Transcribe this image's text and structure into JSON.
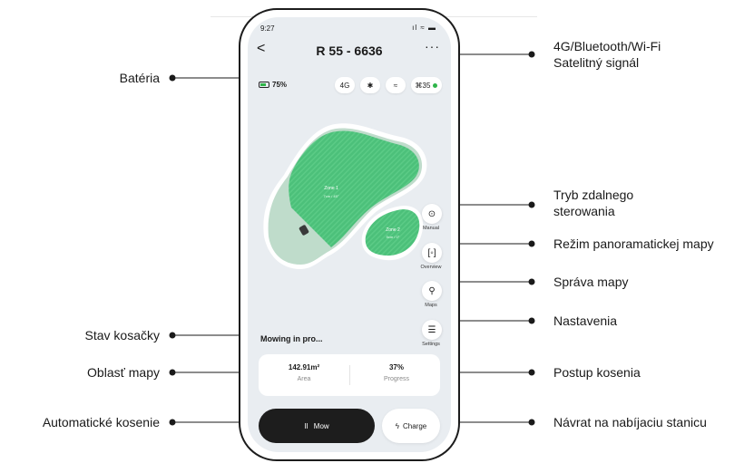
{
  "callouts": {
    "left": {
      "battery": "Batéria",
      "mower_status": "Stav kosačky",
      "map_area": "Oblasť mapy",
      "auto_mowing": "Automatické kosenie"
    },
    "right": {
      "signal_line1": "4G/Bluetooth/Wi-Fi",
      "signal_line2": "Satelitný signál",
      "remote_line1": "Tryb zdalnego",
      "remote_line2": "sterowania",
      "panorama": "Režim panoramatickej mapy",
      "map_manage": "Správa mapy",
      "settings": "Nastavenia",
      "progress": "Postup kosenia",
      "return": "Návrat na nabíjaciu stanicu"
    }
  },
  "phone": {
    "time": "9:27",
    "status_icons": "ıl ≈ ▬",
    "back": "<",
    "title": "R 55 - 6636",
    "more": "···",
    "battery_label": "75%",
    "battery_level": 0.75,
    "signal_4g": "4G",
    "bluetooth": "✱",
    "wifi": "≈",
    "satellites": "35",
    "zones": [
      {
        "name": "Zone 1",
        "detail": "7cm / 45°"
      },
      {
        "name": "Zone 2",
        "detail": "5cm / 0°"
      }
    ],
    "side_buttons": {
      "manual": "Manual",
      "overview": "Overview",
      "maps": "Maps",
      "settings": "Settings"
    },
    "mow_status": "Mowing in pro...",
    "area_value": "142.91m²",
    "area_label": "Area",
    "progress_value": "37%",
    "progress_label": "Progress",
    "mow_button": "Mow",
    "mow_icon": "II",
    "charge_button": "Charge",
    "charge_icon": "ϟ"
  },
  "colors": {
    "zone_green": "#4cc07a",
    "mowed_green": "#bfdccb",
    "map_bg": "#e9edf1",
    "dark_button": "#1d1d1d"
  }
}
